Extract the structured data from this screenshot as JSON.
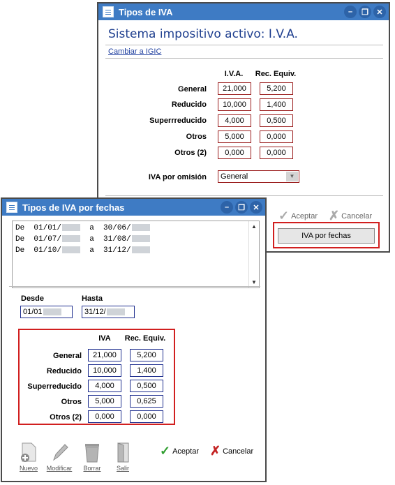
{
  "w1": {
    "title": "Tipos de IVA",
    "system_title": "Sistema impositivo activo:  I.V.A.",
    "link": "Cambiar a IGIC",
    "col_iva": "I.V.A.",
    "col_rec": "Rec. Equiv.",
    "rows": [
      {
        "label": "General",
        "iva": "21,000",
        "rec": "5,200"
      },
      {
        "label": "Reducido",
        "iva": "10,000",
        "rec": "1,400"
      },
      {
        "label": "Superrreducido",
        "iva": "4,000",
        "rec": "0,500"
      },
      {
        "label": "Otros",
        "iva": "5,000",
        "rec": "0,000"
      },
      {
        "label": "Otros (2)",
        "iva": "0,000",
        "rec": "0,000"
      }
    ],
    "default_label": "IVA por omisión",
    "default_value": "General",
    "accept": "Aceptar",
    "cancel": "Cancelar",
    "by_dates_button": "IVA por fechas"
  },
  "w2": {
    "title": "Tipos de IVA por fechas",
    "list": [
      {
        "de": "De",
        "from": "01/01/",
        "a": "a",
        "to": "30/06/"
      },
      {
        "de": "De",
        "from": "01/07/",
        "a": "a",
        "to": "31/08/"
      },
      {
        "de": "De",
        "from": "01/10/",
        "a": "a",
        "to": "31/12/"
      }
    ],
    "desde_label": "Desde",
    "hasta_label": "Hasta",
    "desde_value": "01/01",
    "hasta_value": "31/12/",
    "col_iva": "IVA",
    "col_rec": "Rec. Equiv.",
    "rows": [
      {
        "label": "General",
        "iva": "21,000",
        "rec": "5,200"
      },
      {
        "label": "Reducido",
        "iva": "10,000",
        "rec": "1,400"
      },
      {
        "label": "Superreducido",
        "iva": "4,000",
        "rec": "0,500"
      },
      {
        "label": "Otros",
        "iva": "5,000",
        "rec": "0,625"
      },
      {
        "label": "Otros (2)",
        "iva": "0,000",
        "rec": "0,000"
      }
    ],
    "tools": [
      "Nuevo",
      "Modificar",
      "Borrar",
      "Salir"
    ],
    "accept": "Aceptar",
    "cancel": "Cancelar"
  },
  "colors": {
    "titlebar": "#3e7bc4",
    "highlight": "#d11f1f",
    "field_border_w1": "#9a1c1c",
    "field_border_w2": "#1f2f8f"
  }
}
